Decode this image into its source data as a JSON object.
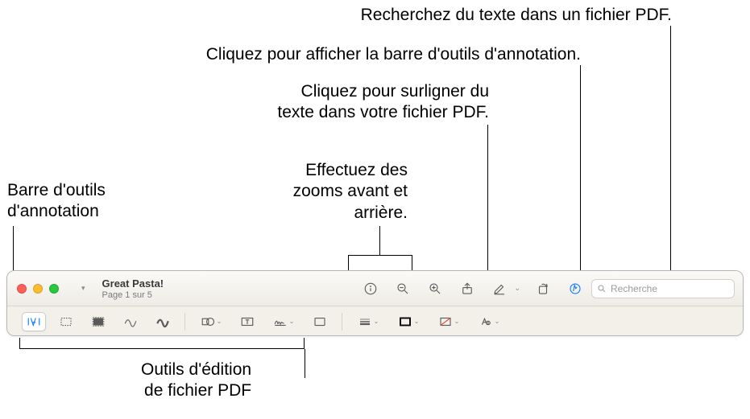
{
  "callouts": {
    "search_pdf": "Recherchez du texte dans un fichier PDF.",
    "annotation_toolbar_click": "Cliquez pour afficher la barre d'outils d'annotation.",
    "highlight_click": "Cliquez pour surligner du\ntexte dans votre fichier PDF.",
    "zoom": "Effectuez des\nzooms avant et\narrière.",
    "annotation_toolbar_label": "Barre d'outils\nd'annotation",
    "edit_tools_label": "Outils d'édition\nde fichier PDF"
  },
  "window": {
    "title": "Great Pasta!",
    "subtitle": "Page 1 sur 5",
    "search_placeholder": "Recherche"
  },
  "colors": {
    "accent": "#0a7aff"
  }
}
